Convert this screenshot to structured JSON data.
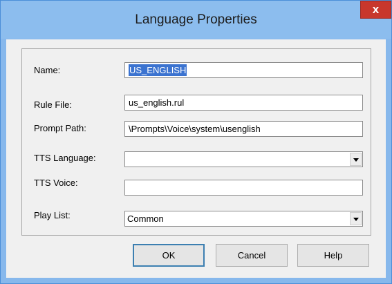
{
  "window": {
    "title": "Language Properties",
    "close_label": "x"
  },
  "form": {
    "name": {
      "label": "Name:",
      "value": "US_ENGLISH"
    },
    "rule_file": {
      "label": "Rule File:",
      "value": "us_english.rul"
    },
    "prompt_path": {
      "label": "Prompt Path:",
      "value": "\\Prompts\\Voice\\system\\usenglish"
    },
    "tts_language": {
      "label": "TTS Language:",
      "value": ""
    },
    "tts_voice": {
      "label": "TTS Voice:",
      "value": ""
    },
    "play_list": {
      "label": "Play List:",
      "value": "Common"
    }
  },
  "buttons": {
    "ok": "OK",
    "cancel": "Cancel",
    "help": "Help"
  }
}
